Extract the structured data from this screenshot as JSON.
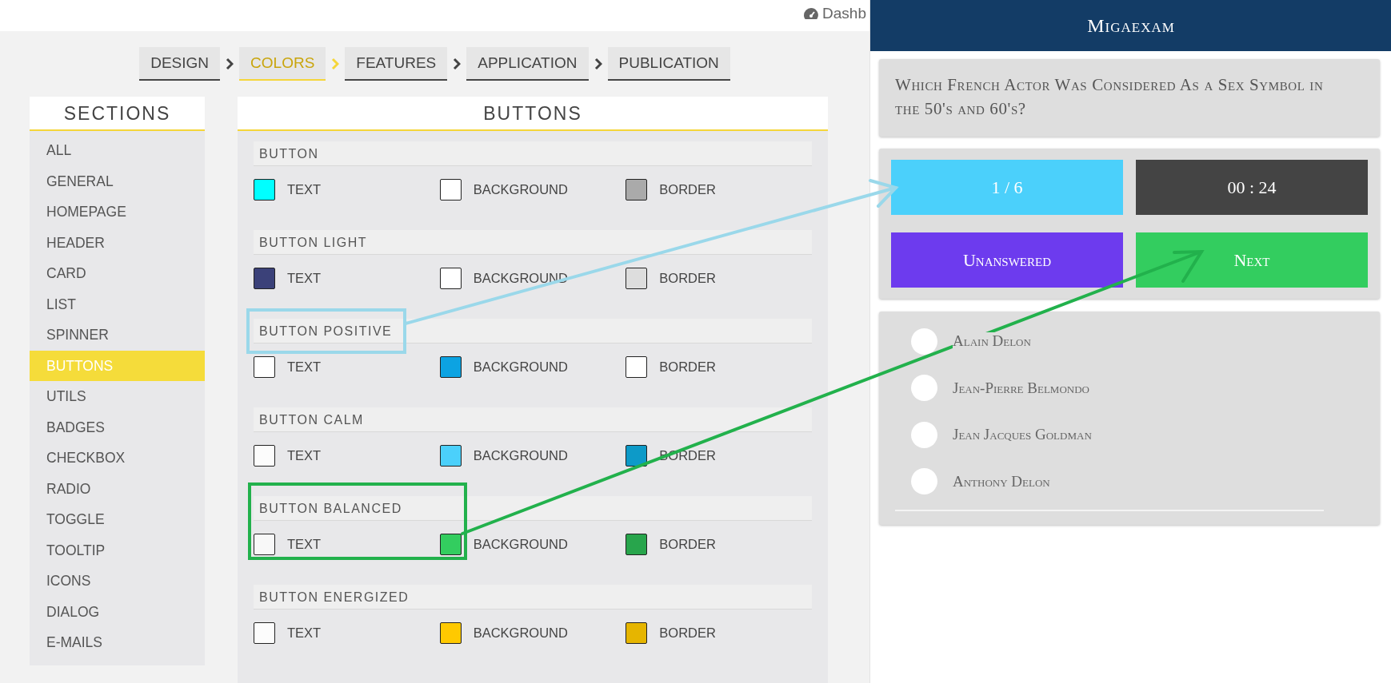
{
  "top_bar": {
    "link": "Dashb"
  },
  "steps": [
    {
      "label": "DESIGN",
      "selected": false
    },
    {
      "label": "COLORS",
      "selected": true
    },
    {
      "label": "FEATURES",
      "selected": false
    },
    {
      "label": "APPLICATION",
      "selected": false
    },
    {
      "label": "PUBLICATION",
      "selected": false
    }
  ],
  "sidebar": {
    "title": "SECTIONS",
    "items": [
      {
        "label": "ALL",
        "selected": false
      },
      {
        "label": "GENERAL",
        "selected": false
      },
      {
        "label": "HOMEPAGE",
        "selected": false
      },
      {
        "label": "HEADER",
        "selected": false
      },
      {
        "label": "CARD",
        "selected": false
      },
      {
        "label": "LIST",
        "selected": false
      },
      {
        "label": "SPINNER",
        "selected": false
      },
      {
        "label": "BUTTONS",
        "selected": true
      },
      {
        "label": "UTILS",
        "selected": false
      },
      {
        "label": "BADGES",
        "selected": false
      },
      {
        "label": "CHECKBOX",
        "selected": false
      },
      {
        "label": "RADIO",
        "selected": false
      },
      {
        "label": "TOGGLE",
        "selected": false
      },
      {
        "label": "TOOLTIP",
        "selected": false
      },
      {
        "label": "ICONS",
        "selected": false
      },
      {
        "label": "DIALOG",
        "selected": false
      },
      {
        "label": "E-MAILS",
        "selected": false
      }
    ]
  },
  "panel": {
    "title": "BUTTONS",
    "groups": [
      {
        "title": "BUTTON",
        "swatches": [
          {
            "label": "TEXT",
            "color": "#00ffff"
          },
          {
            "label": "BACKGROUND",
            "color": "#ffffff"
          },
          {
            "label": "BORDER",
            "color": "#aaaaaa"
          }
        ]
      },
      {
        "title": "BUTTON LIGHT",
        "swatches": [
          {
            "label": "TEXT",
            "color": "#3b4179"
          },
          {
            "label": "BACKGROUND",
            "color": "#ffffff"
          },
          {
            "label": "BORDER",
            "color": "#dddddd"
          }
        ]
      },
      {
        "title": "BUTTON POSITIVE",
        "swatches": [
          {
            "label": "TEXT",
            "color": "#ffffff"
          },
          {
            "label": "BACKGROUND",
            "color": "#0ca3e2"
          },
          {
            "label": "BORDER",
            "color": "#ffffff"
          }
        ]
      },
      {
        "title": "BUTTON CALM",
        "swatches": [
          {
            "label": "TEXT",
            "color": "#fcfcfc"
          },
          {
            "label": "BACKGROUND",
            "color": "#4bd0fb"
          },
          {
            "label": "BORDER",
            "color": "#0d9ac8"
          }
        ]
      },
      {
        "title": "BUTTON BALANCED",
        "swatches": [
          {
            "label": "TEXT",
            "color": "#f8f8f8"
          },
          {
            "label": "BACKGROUND",
            "color": "#33cd5f"
          },
          {
            "label": "BORDER",
            "color": "#28a54c"
          }
        ]
      },
      {
        "title": "BUTTON ENERGIZED",
        "swatches": [
          {
            "label": "TEXT",
            "color": "#fcfcfc"
          },
          {
            "label": "BACKGROUND",
            "color": "#ffc900"
          },
          {
            "label": "BORDER",
            "color": "#e6b500"
          }
        ]
      }
    ]
  },
  "phone": {
    "title": "Migaexam",
    "question": "Which French Actor Was Considered As a Sex Symbol in the 50's and 60's?",
    "tiles": [
      {
        "label": "1 / 6",
        "color": "#4bd0fb"
      },
      {
        "label": "00 : 24",
        "color": "#444444"
      },
      {
        "label": "Unanswered",
        "color": "#6d3bee"
      },
      {
        "label": "Next",
        "color": "#33cd5f"
      }
    ],
    "answers": [
      {
        "label": "Alain Delon",
        "selected": false
      },
      {
        "label": "Jean-Pierre Belmondo",
        "selected": false
      },
      {
        "label": "Jean Jacques Goldman",
        "selected": false
      },
      {
        "label": "Anthony Delon",
        "selected": false
      }
    ]
  }
}
